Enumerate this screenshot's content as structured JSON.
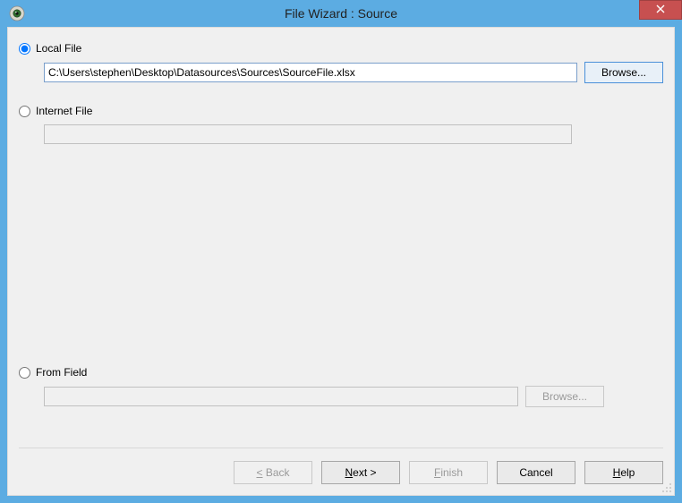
{
  "window": {
    "title": "File Wizard : Source"
  },
  "source": {
    "local": {
      "label": "Local File",
      "path": "C:\\Users\\stephen\\Desktop\\Datasources\\Sources\\SourceFile.xlsx",
      "browse": "Browse..."
    },
    "internet": {
      "label": "Internet File",
      "url": ""
    },
    "from_field": {
      "label": "From Field",
      "value": "",
      "browse": "Browse..."
    },
    "selected": "local"
  },
  "buttons": {
    "back_prefix": "<",
    "back": " Back",
    "next": "ext >",
    "next_ul": "N",
    "finish": "inish",
    "finish_ul": "F",
    "cancel": "Cancel",
    "help": "elp",
    "help_ul": "H"
  }
}
